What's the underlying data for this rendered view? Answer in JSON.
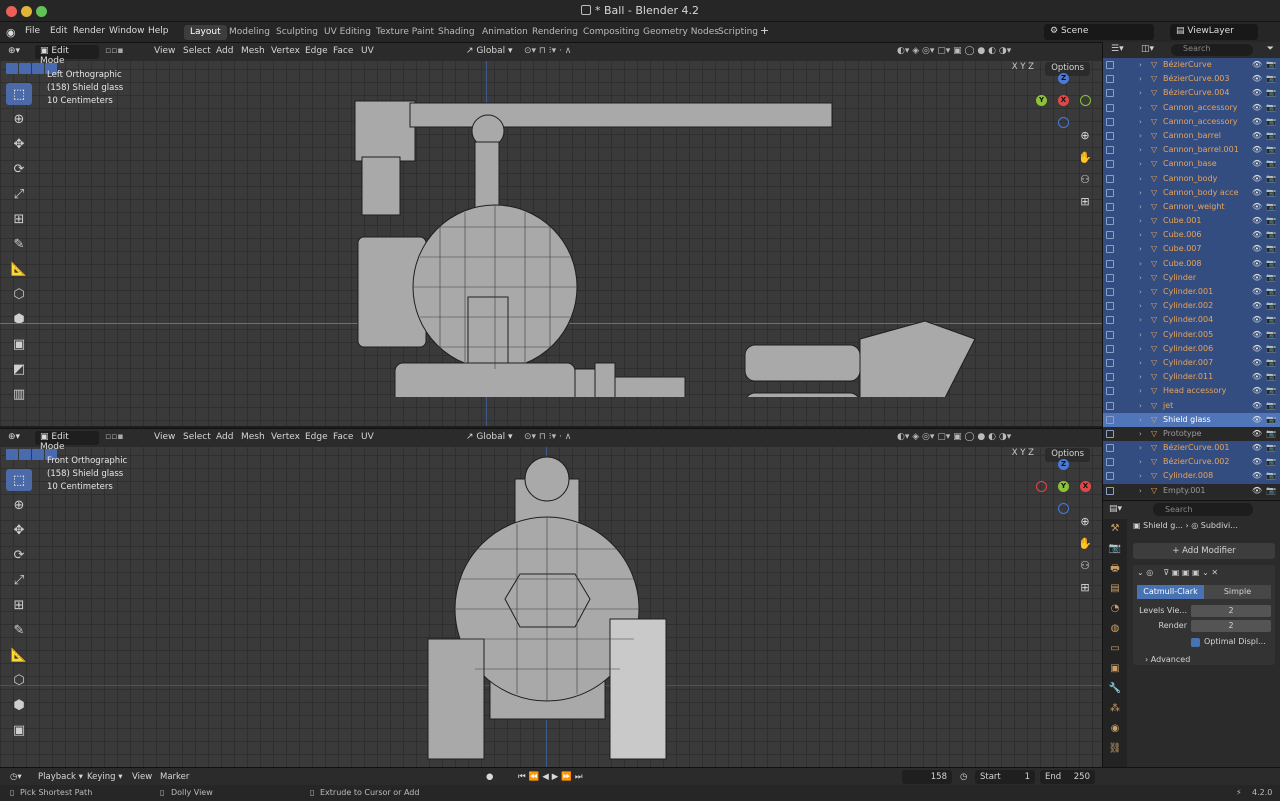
{
  "window": {
    "title": "* Ball - Blender 4.2"
  },
  "menu": {
    "items": [
      "File",
      "Edit",
      "Render",
      "Window",
      "Help"
    ]
  },
  "workspaces": [
    "Layout",
    "Modeling",
    "Sculpting",
    "UV Editing",
    "Texture Paint",
    "Shading",
    "Animation",
    "Rendering",
    "Compositing",
    "Geometry Nodes",
    "Scripting"
  ],
  "active_workspace": "Layout",
  "scene": {
    "name": "Scene",
    "view_layer": "ViewLayer"
  },
  "viewport_header": {
    "mode": "Edit Mode",
    "menus": [
      "View",
      "Select",
      "Add",
      "Mesh",
      "Vertex",
      "Edge",
      "Face",
      "UV"
    ],
    "orientation": "Global",
    "options": "Options",
    "axes": "X Y Z"
  },
  "viewport_top": {
    "view_name": "Left Orthographic",
    "object": "(158) Shield glass",
    "scale": "10 Centimeters"
  },
  "viewport_bottom": {
    "view_name": "Front Orthographic",
    "object": "(158) Shield glass",
    "scale": "10 Centimeters"
  },
  "outliner": {
    "search_placeholder": "Search",
    "rows": [
      {
        "name": "BézierCurve",
        "state": "sel"
      },
      {
        "name": "BézierCurve.003",
        "state": "sel"
      },
      {
        "name": "BézierCurve.004",
        "state": "sel"
      },
      {
        "name": "Cannon_accessory",
        "state": "sel"
      },
      {
        "name": "Cannon_accessory",
        "state": "sel"
      },
      {
        "name": "Cannon_barrel",
        "state": "sel"
      },
      {
        "name": "Cannon_barrel.001",
        "state": "sel"
      },
      {
        "name": "Cannon_base",
        "state": "sel"
      },
      {
        "name": "Cannon_body",
        "state": "sel"
      },
      {
        "name": "Cannon_body acce",
        "state": "sel"
      },
      {
        "name": "Cannon_weight",
        "state": "sel"
      },
      {
        "name": "Cube.001",
        "state": "sel"
      },
      {
        "name": "Cube.006",
        "state": "sel"
      },
      {
        "name": "Cube.007",
        "state": "sel"
      },
      {
        "name": "Cube.008",
        "state": "sel"
      },
      {
        "name": "Cylinder",
        "state": "sel"
      },
      {
        "name": "Cylinder.001",
        "state": "sel"
      },
      {
        "name": "Cylinder.002",
        "state": "sel"
      },
      {
        "name": "Cylinder.004",
        "state": "sel"
      },
      {
        "name": "Cylinder.005",
        "state": "sel"
      },
      {
        "name": "Cylinder.006",
        "state": "sel"
      },
      {
        "name": "Cylinder.007",
        "state": "sel"
      },
      {
        "name": "Cylinder.011",
        "state": "sel"
      },
      {
        "name": "Head accessory",
        "state": "sel"
      },
      {
        "name": "jet",
        "state": "sel"
      },
      {
        "name": "Shield glass",
        "state": "active"
      },
      {
        "name": "Prototype",
        "state": "dim"
      },
      {
        "name": "BézierCurve.001",
        "state": "sel"
      },
      {
        "name": "BézierCurve.002",
        "state": "sel"
      },
      {
        "name": "Cylinder.008",
        "state": "sel"
      },
      {
        "name": "Empty.001",
        "state": "dim"
      }
    ]
  },
  "properties": {
    "search_placeholder": "Search",
    "object_name": "Shield g...",
    "modifier_name": "Subdivi...",
    "add_modifier": "Add Modifier",
    "subdivision": {
      "mode_options": [
        "Catmull-Clark",
        "Simple"
      ],
      "selected_mode": "Catmull-Clark",
      "levels_viewport_label": "Levels Vie...",
      "levels_viewport": "2",
      "render_label": "Render",
      "render": "2",
      "optimal_display": "Optimal Displ...",
      "advanced": "Advanced"
    }
  },
  "timeline": {
    "menus": [
      "Playback",
      "Keying",
      "View",
      "Marker"
    ],
    "current_frame": "158",
    "start_label": "Start",
    "start": "1",
    "end_label": "End",
    "end": "250"
  },
  "statusbar": {
    "hint1": "Pick Shortest Path",
    "hint2": "Dolly View",
    "hint3": "Extrude to Cursor or Add",
    "version": "4.2.0"
  },
  "colors": {
    "selection": "#334d80",
    "active": "#5075b8",
    "accent_orange": "#e8a35a"
  }
}
